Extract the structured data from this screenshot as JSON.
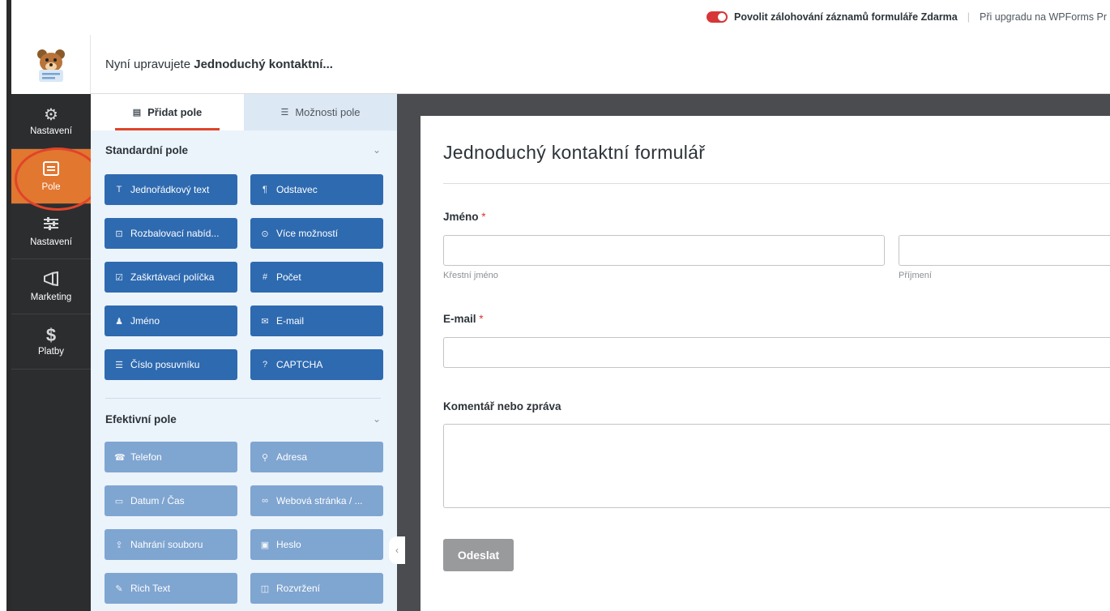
{
  "notice": {
    "toggle_text": "Povolit zálohování záznamů formuláře Zdarma",
    "separator": "|",
    "upgrade_text": "Při upgradu na WPForms Pr"
  },
  "header": {
    "prefix": "Nyní upravujete ",
    "form_name": "Jednoduchý kontaktní..."
  },
  "sidenav": {
    "items": [
      {
        "label": "Nastavení",
        "icon": "gear-icon"
      },
      {
        "label": "Pole",
        "icon": "fields-icon"
      },
      {
        "label": "Nastavení",
        "icon": "sliders-icon"
      },
      {
        "label": "Marketing",
        "icon": "megaphone-icon"
      },
      {
        "label": "Platby",
        "icon": "dollar-icon"
      }
    ]
  },
  "panel": {
    "tabs": [
      {
        "label": "Přidat pole",
        "icon": "table-icon"
      },
      {
        "label": "Možnosti pole",
        "icon": "sliders-icon"
      }
    ],
    "standard": {
      "title": "Standardní pole",
      "fields": [
        {
          "label": "Jednořádkový text",
          "icon": "text-icon"
        },
        {
          "label": "Odstavec",
          "icon": "paragraph-icon"
        },
        {
          "label": "Rozbalovací nabíd...",
          "icon": "dropdown-icon"
        },
        {
          "label": "Více možností",
          "icon": "radio-icon"
        },
        {
          "label": "Zaškrtávací políčka",
          "icon": "checkbox-icon"
        },
        {
          "label": "Počet",
          "icon": "hash-icon"
        },
        {
          "label": "Jméno",
          "icon": "user-icon"
        },
        {
          "label": "E-mail",
          "icon": "envelope-icon"
        },
        {
          "label": "Číslo posuvníku",
          "icon": "slider-icon"
        },
        {
          "label": "CAPTCHA",
          "icon": "question-icon"
        }
      ]
    },
    "fancy": {
      "title": "Efektivní pole",
      "fields": [
        {
          "label": "Telefon",
          "icon": "phone-icon"
        },
        {
          "label": "Adresa",
          "icon": "map-pin-icon"
        },
        {
          "label": "Datum / Čas",
          "icon": "calendar-icon"
        },
        {
          "label": "Webová stránka / ...",
          "icon": "link-icon"
        },
        {
          "label": "Nahrání souboru",
          "icon": "upload-icon"
        },
        {
          "label": "Heslo",
          "icon": "lock-icon"
        },
        {
          "label": "Rich Text",
          "icon": "edit-icon"
        },
        {
          "label": "Rozvržení",
          "icon": "columns-icon"
        }
      ]
    }
  },
  "form": {
    "title": "Jednoduchý kontaktní formulář",
    "name_label": "Jméno",
    "first_name_sub": "Křestní jméno",
    "last_name_sub": "Příjmení",
    "email_label": "E-mail",
    "comment_label": "Komentář nebo zpráva",
    "required_mark": "*",
    "submit_label": "Odeslat"
  },
  "colors": {
    "accent": "#e27730",
    "button_blue": "#2e6ab0",
    "button_blue_light": "#7fa5d1",
    "sidebar": "#2c2d2f",
    "highlight_circle": "#e0442a"
  }
}
